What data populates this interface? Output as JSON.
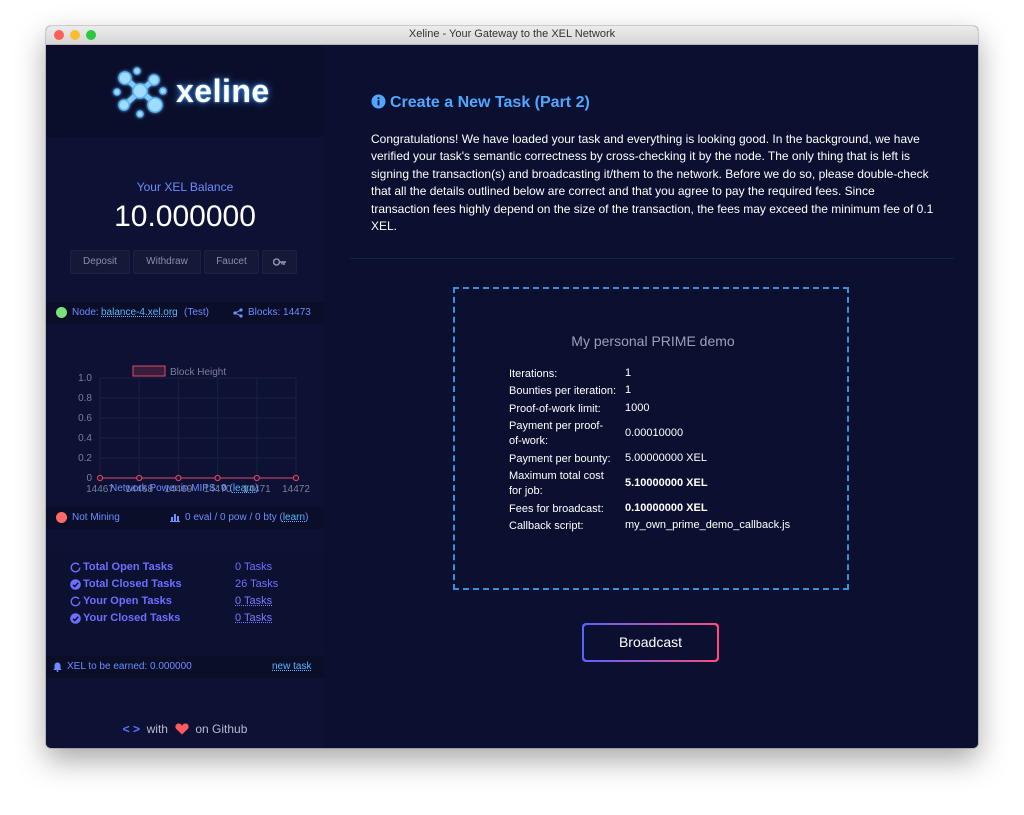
{
  "window": {
    "title": "Xeline - Your Gateway to the XEL Network"
  },
  "logo": {
    "text": "xeline"
  },
  "balance": {
    "label": "Your XEL Balance",
    "value": "10.000000",
    "buttons": [
      "Deposit",
      "Withdraw",
      "Faucet"
    ],
    "key_icon": "key-icon"
  },
  "node": {
    "prefix": "Node:",
    "host": "balance-4.xel.org",
    "network": "(Test)",
    "blocks_label": "Blocks: 14473",
    "status_color": "#7be07b"
  },
  "chart_data": {
    "type": "line",
    "legend": "Block Height",
    "x": [
      "14467",
      "14468",
      "14469",
      "14470",
      "14471",
      "14472"
    ],
    "values": [
      0,
      0,
      0,
      0,
      0,
      0
    ],
    "y_ticks": [
      "1.0",
      "0.8",
      "0.6",
      "0.4",
      "0.2",
      "0"
    ],
    "ylim": [
      0,
      1
    ],
    "color": "#e0496b"
  },
  "network_power": {
    "label": "Network Power in MIPS:",
    "value": "0",
    "learn": "learn"
  },
  "mining": {
    "status": "Not Mining",
    "status_color": "#ff6b6b",
    "stats": "0 eval / 0 pow / 0 bty",
    "learn": "learn"
  },
  "tasks": [
    {
      "label": "Total Open Tasks",
      "value": "0 Tasks",
      "icon": "circle-outline-icon",
      "underline": false
    },
    {
      "label": "Total Closed Tasks",
      "value": "26 Tasks",
      "icon": "check-circle-icon",
      "underline": false
    },
    {
      "label": "Your Open Tasks",
      "value": "0 Tasks",
      "icon": "circle-outline-icon",
      "underline": true
    },
    {
      "label": "Your Closed Tasks",
      "value": "0 Tasks",
      "icon": "check-circle-icon",
      "underline": true
    }
  ],
  "earn": {
    "label": "XEL to be earned: 0.000000",
    "new_task": "new task"
  },
  "footer": {
    "with": "with",
    "on_github": "on Github"
  },
  "main": {
    "heading": "Create a New Task (Part 2)",
    "paragraph": "Congratulations! We have loaded your task and everything is looking good. In the background, we have verified your task's semantic correctness by cross-checking it by the node. The only thing that is left is signing the transaction(s) and broadcasting it/them to the network. Before we do so, please double-check that all the details outlined below are correct and that you agree to pay the required fees. Since transaction fees highly depend on the size of the transaction, the fees may exceed the minimum fee of 0.1 XEL.",
    "task_name": "My personal PRIME demo",
    "details": [
      {
        "label": "Iterations:",
        "value": "1",
        "bold": false
      },
      {
        "label": "Bounties per iteration:",
        "value": "1",
        "bold": false
      },
      {
        "label": "Proof-of-work limit:",
        "value": "1000",
        "bold": false
      },
      {
        "label": "Payment per proof-of-work:",
        "value": "0.00010000",
        "bold": false
      },
      {
        "label": "Payment per bounty:",
        "value": "5.00000000 XEL",
        "bold": false
      },
      {
        "label": "Maximum total cost for job:",
        "value": "5.10000000 XEL",
        "bold": true
      },
      {
        "label": "Fees for broadcast:",
        "value": "0.10000000 XEL",
        "bold": true
      },
      {
        "label": "Callback script:",
        "value": "my_own_prime_demo_callback.js",
        "bold": false
      }
    ],
    "broadcast_label": "Broadcast"
  }
}
